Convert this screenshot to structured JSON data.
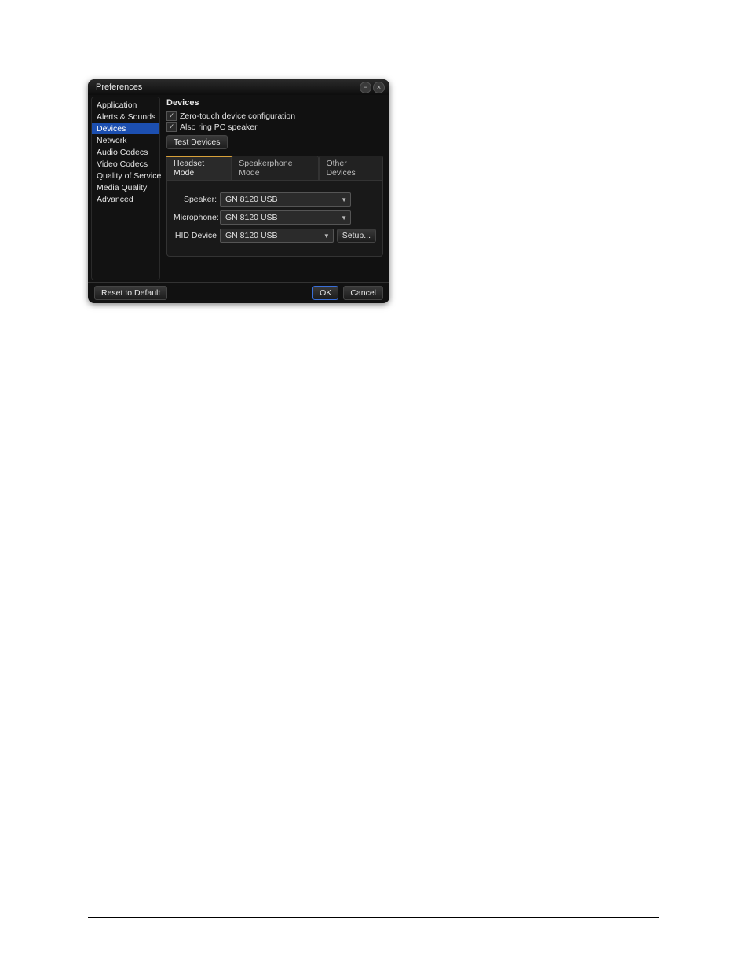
{
  "window": {
    "title": "Preferences"
  },
  "sidebar": {
    "items": [
      {
        "label": "Application"
      },
      {
        "label": "Alerts & Sounds"
      },
      {
        "label": "Devices",
        "selected": true
      },
      {
        "label": "Network"
      },
      {
        "label": "Audio Codecs"
      },
      {
        "label": "Video Codecs"
      },
      {
        "label": "Quality of Service"
      },
      {
        "label": "Media Quality"
      },
      {
        "label": "Advanced"
      }
    ]
  },
  "panel": {
    "title": "Devices",
    "checks": {
      "zero_touch": "Zero-touch device configuration",
      "also_ring": "Also ring PC speaker"
    },
    "test_button": "Test Devices",
    "tabs": [
      {
        "label": "Headset Mode",
        "active": true
      },
      {
        "label": "Speakerphone Mode"
      },
      {
        "label": "Other Devices"
      }
    ],
    "fields": {
      "speaker_label": "Speaker:",
      "speaker_value": "GN 8120 USB",
      "mic_label": "Microphone:",
      "mic_value": "GN 8120 USB",
      "hid_label": "HID Device",
      "hid_value": "GN 8120 USB",
      "setup_label": "Setup..."
    }
  },
  "footer": {
    "reset": "Reset to Default",
    "ok": "OK",
    "cancel": "Cancel"
  }
}
